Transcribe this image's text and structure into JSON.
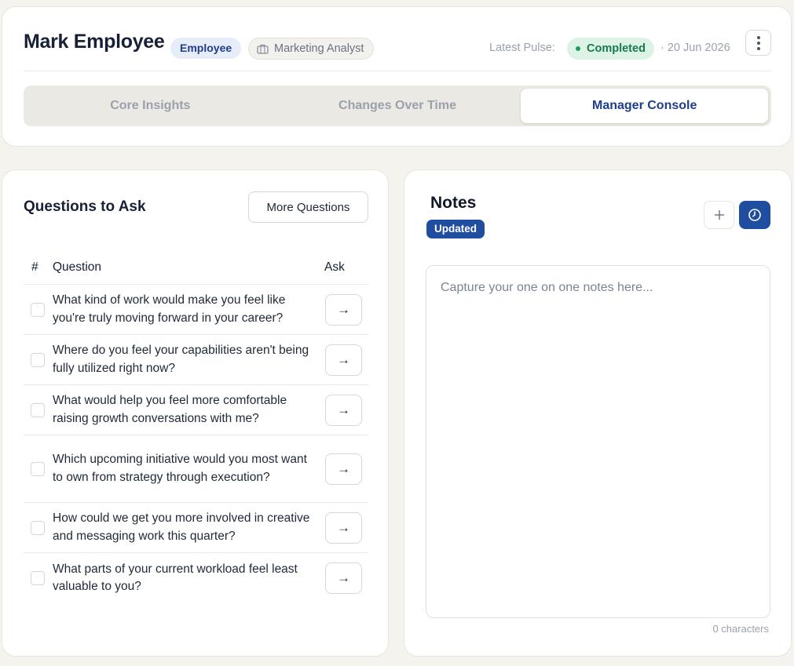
{
  "header": {
    "employee_name": "Mark Employee",
    "role_badge": "Employee",
    "job_title": "Marketing Analyst",
    "pulse_label": "Latest Pulse:",
    "pulse_status": "Completed",
    "pulse_date": "· 20 Jun 2026",
    "tabs": [
      {
        "label": "Core Insights",
        "active": false
      },
      {
        "label": "Changes Over Time",
        "active": false
      },
      {
        "label": "Manager Console",
        "active": true
      }
    ]
  },
  "questions": {
    "title": "Questions to Ask",
    "more_button": "More Questions",
    "columns": {
      "num": "#",
      "question": "Question",
      "ask": "Ask"
    },
    "items": [
      {
        "text": "What kind of work would make you feel like you're truly moving forward in your career?",
        "checked": false
      },
      {
        "text": "Where do you feel your capabilities aren't being fully utilized right now?",
        "checked": false
      },
      {
        "text": "What would help you feel more comfortable raising growth conversations with me?",
        "checked": false
      },
      {
        "text": "Which upcoming initiative would you most want to own from strategy through execution?",
        "checked": false
      },
      {
        "text": "How could we get you more involved in creative and messaging work this quarter?",
        "checked": false
      },
      {
        "text": "What parts of your current workload feel least valuable to you?",
        "checked": false
      }
    ]
  },
  "notes": {
    "title": "Notes",
    "badge": "Updated",
    "placeholder": "Capture your one on one notes here...",
    "value": "",
    "char_count": "0 characters"
  },
  "colors": {
    "accent": "#1f4ea0",
    "status_green": "#18794e",
    "background": "#f4f3ee"
  },
  "icons": {
    "role": "briefcase-icon",
    "menu": "vertical-dots-icon",
    "ask": "arrow-right-icon",
    "add": "plus-icon",
    "history": "clock-icon"
  }
}
